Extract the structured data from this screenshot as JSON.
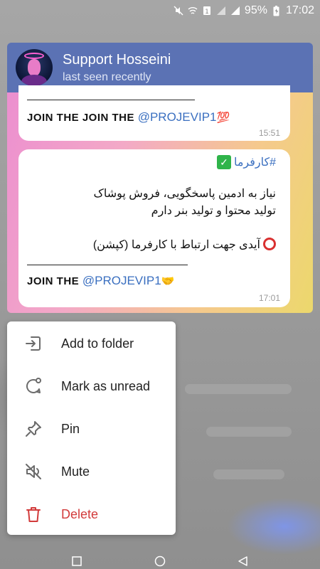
{
  "status_bar": {
    "battery": "95%",
    "time": "17:02"
  },
  "chat": {
    "name": "Support Hosseini",
    "status": "last seen recently",
    "messages": [
      {
        "join_prefix": "JOIN THE JOIN THE ",
        "join_link": "@PROJEVIP1",
        "emoji": "💯",
        "time": "15:51"
      },
      {
        "hashtag": "#کارفرما",
        "line1": "نیاز به ادمین پاسخگویی، فروش پوشاک",
        "line2": "تولید محتوا و تولید بنر دارم",
        "line3": "آیدی جهت ارتباط با کارفرما (کپشن)",
        "join_prefix": "JOIN THE ",
        "join_link": "@PROJEVIP1",
        "emoji": "🤝",
        "time": "17:01"
      }
    ]
  },
  "menu": {
    "items": [
      {
        "label": "Add to folder",
        "icon": "folder-add-icon"
      },
      {
        "label": "Mark as unread",
        "icon": "chat-unread-icon"
      },
      {
        "label": "Pin",
        "icon": "pin-icon"
      },
      {
        "label": "Mute",
        "icon": "mute-icon"
      },
      {
        "label": "Delete",
        "icon": "trash-icon",
        "color": "#d23b3b"
      }
    ]
  },
  "colors": {
    "header": "#5b72b4",
    "link": "#3a6fc0",
    "danger": "#d23b3b"
  }
}
